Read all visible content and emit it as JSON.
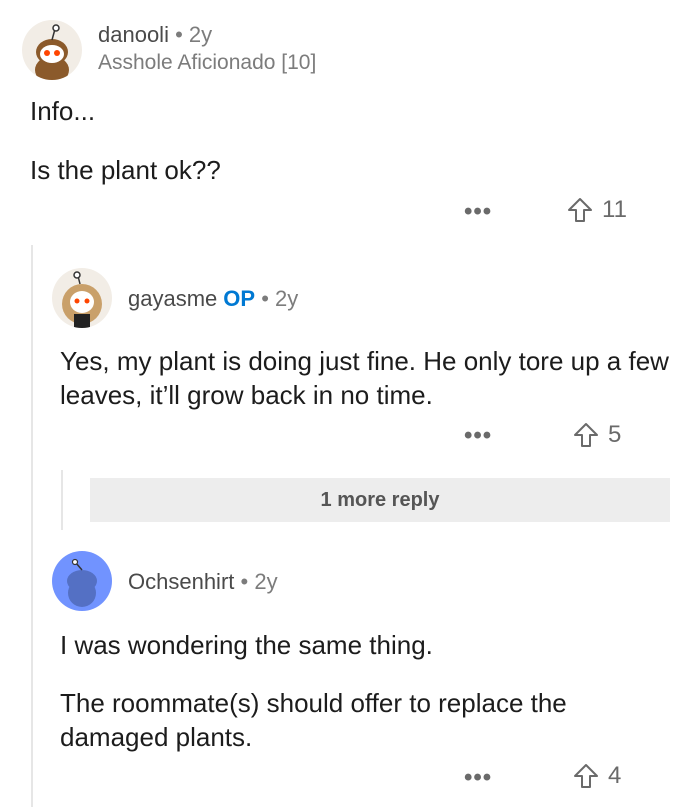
{
  "comments": [
    {
      "username": "danooli",
      "age": "2y",
      "flair": "Asshole Aficionado [10]",
      "paragraphs": [
        "Info...",
        "Is the plant ok??"
      ],
      "votes": "11"
    },
    {
      "username": "gayasme",
      "badge": "OP",
      "age": "2y",
      "paragraphs": [
        "Yes, my plant is doing just fine. He only tore up a few leaves, it’ll grow back in no time."
      ],
      "votes": "5",
      "more_replies": "1 more reply"
    },
    {
      "username": "Ochsenhirt",
      "age": "2y",
      "paragraphs": [
        "I was wondering the same thing.",
        "The roommate(s) should offer to replace the damaged plants."
      ],
      "votes": "4"
    }
  ],
  "overflow_label": "•••",
  "separator": "•",
  "colors": {
    "op_badge": "#0079d3",
    "avatar3_bg": "#7193ff",
    "more_reply_bg": "#ededed"
  }
}
